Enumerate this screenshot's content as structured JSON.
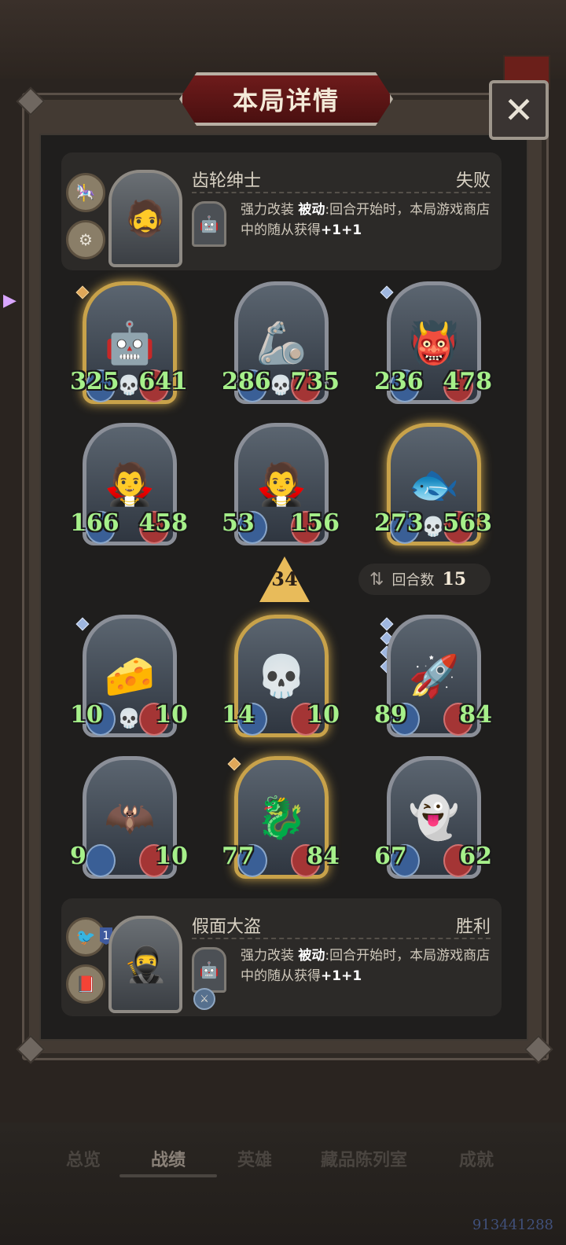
{
  "header": {
    "title": "本局详情",
    "close_glyph": "✕"
  },
  "top_player": {
    "hero_name": "齿轮绅士",
    "result": "失败",
    "trinkets": [
      "carousel-icon",
      "gear-gremlin-icon"
    ],
    "skill": {
      "name": "强力改装",
      "type": "被动",
      "description": ":回合开始时，本局游戏商店中的随从获得",
      "bonus": "+1+1"
    }
  },
  "top_board": [
    {
      "attack": "325",
      "health": "641",
      "frame": "gold",
      "deathrattle": true,
      "pips": 1,
      "pip_color": "gold"
    },
    {
      "attack": "286",
      "health": "735",
      "frame": "silver",
      "deathrattle": true,
      "pips": 0
    },
    {
      "attack": "236",
      "health": "478",
      "frame": "silver",
      "deathrattle": false,
      "pips": 1,
      "pip_color": "silver"
    },
    {
      "attack": "166",
      "health": "458",
      "frame": "silver",
      "deathrattle": false,
      "pips": 0
    },
    {
      "attack": "53",
      "health": "156",
      "frame": "silver",
      "deathrattle": false,
      "pips": 0
    },
    {
      "attack": "273",
      "health": "563",
      "frame": "gold",
      "deathrattle": true,
      "pips": 0
    }
  ],
  "middle": {
    "level": "34",
    "round_label": "回合数",
    "round_value": "15"
  },
  "bottom_board": [
    {
      "attack": "10",
      "health": "10",
      "frame": "silver",
      "deathrattle": true,
      "pips": 1,
      "pip_color": "silver"
    },
    {
      "attack": "14",
      "health": "10",
      "frame": "gold",
      "deathrattle": false,
      "pips": 0
    },
    {
      "attack": "89",
      "health": "84",
      "frame": "silver",
      "deathrattle": false,
      "pips": 4,
      "pip_color": "silver"
    },
    {
      "attack": "9",
      "health": "10",
      "frame": "silver",
      "deathrattle": false,
      "pips": 0
    },
    {
      "attack": "77",
      "health": "84",
      "frame": "gold",
      "deathrattle": false,
      "pips": 1,
      "pip_color": "gold"
    },
    {
      "attack": "67",
      "health": "62",
      "frame": "silver",
      "deathrattle": false,
      "pips": 0
    }
  ],
  "bottom_player": {
    "hero_name": "假面大盗",
    "result": "胜利",
    "trinket_badge": "1",
    "skill": {
      "name": "强力改装",
      "type": "被动",
      "description": ":回合开始时，本局游戏商店中的随从获得",
      "bonus": "+1+1"
    }
  },
  "tabs": [
    {
      "label": "总览",
      "active": false
    },
    {
      "label": "战绩",
      "active": true
    },
    {
      "label": "英雄",
      "active": false
    },
    {
      "label": "藏品陈列室",
      "active": false
    },
    {
      "label": "成就",
      "active": false
    }
  ],
  "watermark": "913441288"
}
